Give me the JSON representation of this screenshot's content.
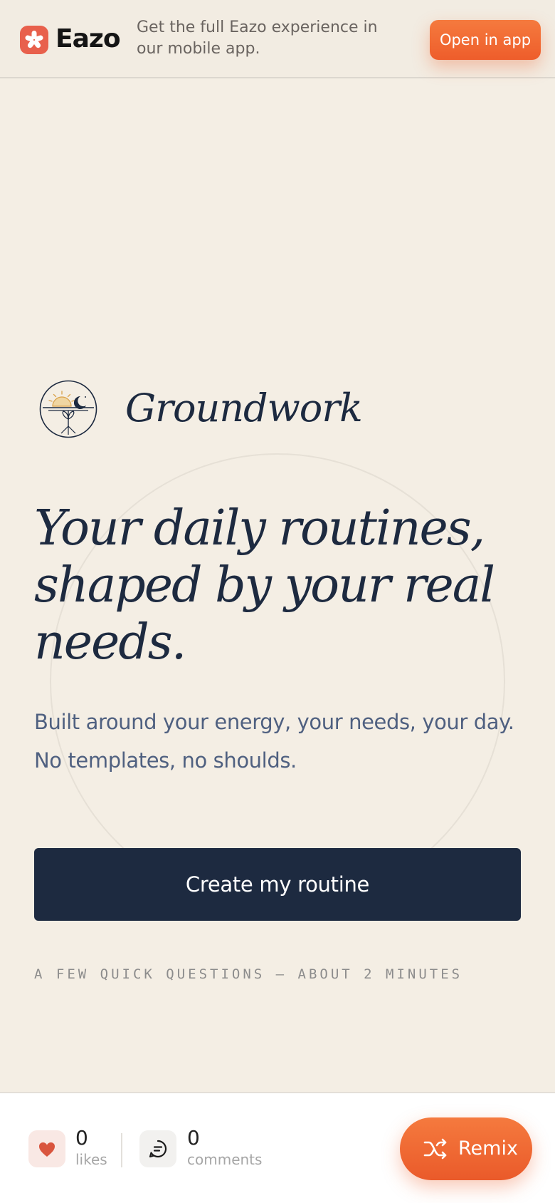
{
  "banner": {
    "brand_name": "Eazo",
    "brand_icon": "asterisk-logo-icon",
    "message": "Get the full Eazo experience in our mobile app.",
    "open_label": "Open in app"
  },
  "hero": {
    "logo_icon": "sunrise-moon-sprout-icon",
    "logo_word": "Groundwork",
    "headline": "Your daily routines, shaped by your real needs.",
    "subtext": "Built around your energy, your needs, your day. No templates, no shoulds.",
    "cta_label": "Create my routine",
    "note": "A FEW QUICK QUESTIONS — ABOUT 2 MINUTES"
  },
  "footer": {
    "likes_count": "0",
    "likes_label": "likes",
    "like_icon": "heart-icon",
    "comments_count": "0",
    "comments_label": "comments",
    "comment_icon": "chat-bubble-icon",
    "remix_label": "Remix",
    "remix_icon": "shuffle-icon"
  },
  "colors": {
    "background": "#f4eee4",
    "accent": "#ee5d2b",
    "navy": "#1d2a40",
    "brand_red": "#e8604c"
  }
}
